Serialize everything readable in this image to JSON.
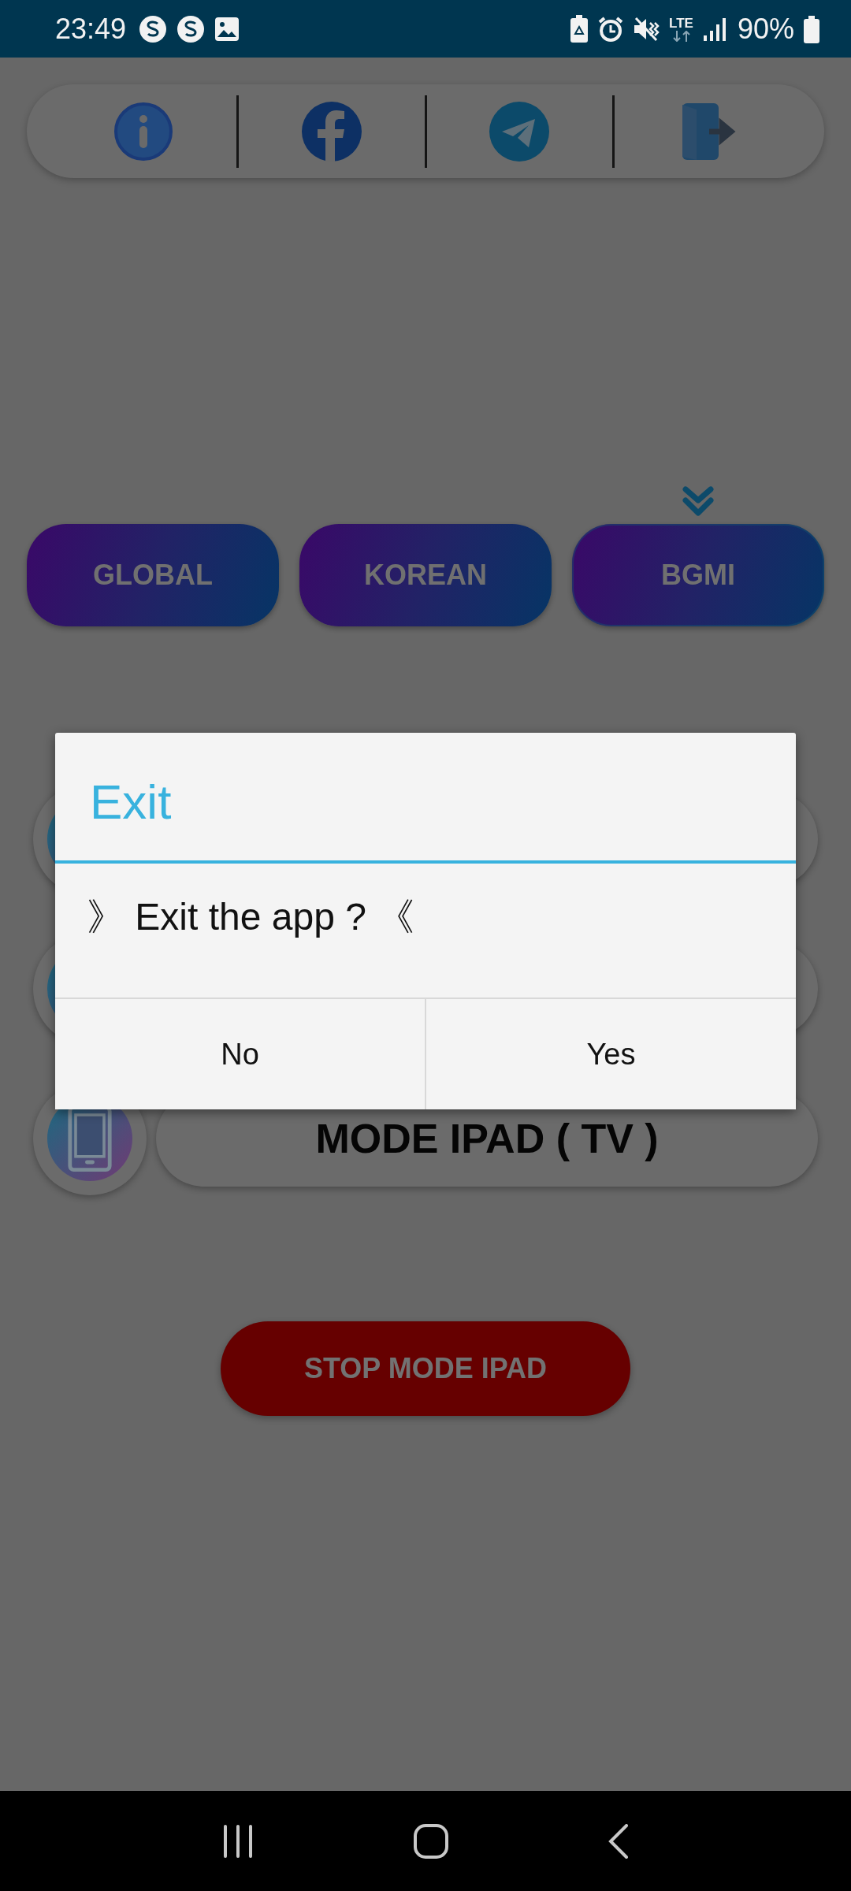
{
  "status_bar": {
    "time": "23:49",
    "battery": "90%",
    "network": "LTE"
  },
  "social_bar": {
    "items": [
      {
        "kind": "info"
      },
      {
        "kind": "facebook"
      },
      {
        "kind": "telegram"
      },
      {
        "kind": "exit"
      }
    ]
  },
  "region_tabs": [
    {
      "label": "GLOBAL",
      "selected": false
    },
    {
      "label": "KOREAN",
      "selected": false
    },
    {
      "label": "BGMI",
      "selected": true
    }
  ],
  "mode_rows": [
    {
      "kind": "covered"
    },
    {
      "kind": "covered"
    },
    {
      "kind": "labeled",
      "label": "MODE IPAD ( TV )"
    }
  ],
  "stop_button": {
    "label": "STOP MODE IPAD"
  },
  "dialog": {
    "title": "Exit",
    "message": "》 Exit the app ? 《",
    "buttons": [
      "No",
      "Yes"
    ]
  }
}
